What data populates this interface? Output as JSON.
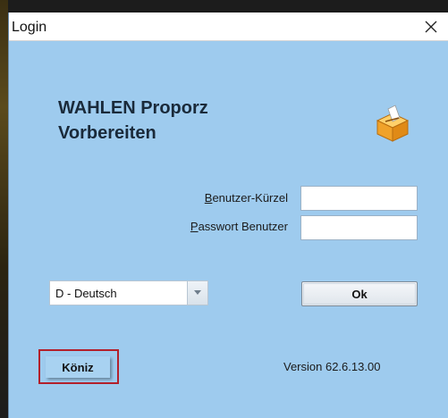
{
  "window": {
    "title": "Login",
    "close_label": "Close"
  },
  "app": {
    "title_line1": "WAHLEN Proporz",
    "title_line2": "Vorbereiten"
  },
  "form": {
    "user_label_accel": "B",
    "user_label_rest": "enutzer-Kürzel",
    "user_value": "",
    "password_label_accel": "P",
    "password_label_rest": "asswort Benutzer",
    "password_value": ""
  },
  "language": {
    "selected": "D - Deutsch"
  },
  "buttons": {
    "ok": "Ok",
    "location": "Köniz"
  },
  "footer": {
    "version": "Version 62.6.13.00"
  },
  "colors": {
    "dialog_bg": "#9ecbee",
    "highlight_border": "#b3202b",
    "icon_orange": "#f0a22a"
  },
  "icons": {
    "app": "ballot-box-icon",
    "close": "close-icon",
    "dropdown": "chevron-down-icon"
  }
}
